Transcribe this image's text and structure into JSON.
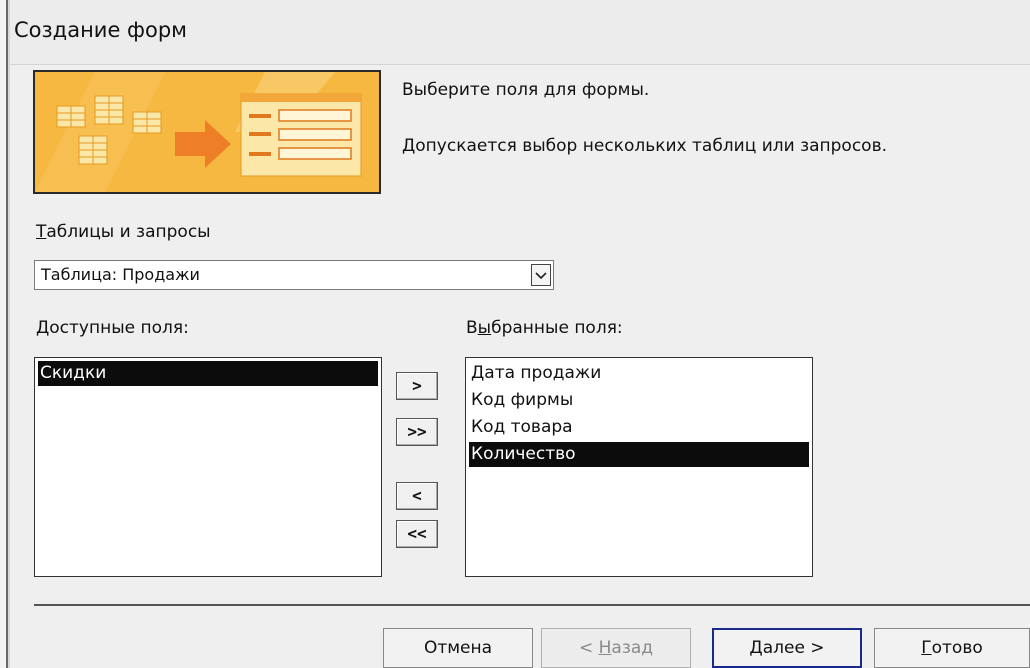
{
  "window": {
    "title": "Создание форм"
  },
  "intro": {
    "line1": "Выберите поля для формы.",
    "line2": "Допускается выбор нескольких таблиц или запросов."
  },
  "tables_queries": {
    "label": "Таблицы и запросы",
    "label_hotkey": "Т",
    "label_rest": "аблицы и запросы",
    "selected": "Таблица: Продажи"
  },
  "available": {
    "label_hotkey": "Д",
    "label_rest": "оступные поля:",
    "items": [
      "Скидки"
    ],
    "selected_index": 0
  },
  "selected_fields": {
    "label_pre": "В",
    "label_hotkey": "ы",
    "label_rest": "бранные поля:",
    "items": [
      "Дата продажи",
      "Код фирмы",
      "Код товара",
      "Количество"
    ],
    "selected_index": 3
  },
  "move_buttons": {
    "add": ">",
    "add_all": ">>",
    "remove": "<",
    "remove_all": "<<"
  },
  "footer": {
    "cancel": "Отмена",
    "back_pre": "< ",
    "back_hotkey": "Н",
    "back_rest": "азад",
    "next_hotkey": "Д",
    "next_rest": "алее >",
    "finish_hotkey": "Г",
    "finish_rest": "отово"
  },
  "colors": {
    "banner": "#f6b840",
    "selection": "#0c0c0c",
    "dialog_bg": "#efefef"
  },
  "icons": {
    "banner": "form-wizard-illustration",
    "dropdown": "chevron-down-icon"
  }
}
